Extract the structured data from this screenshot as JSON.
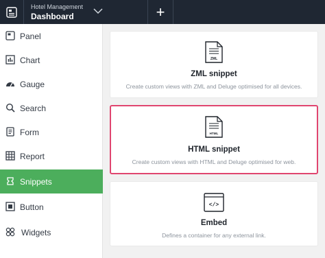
{
  "header": {
    "app_name": "Hotel Management",
    "page_title": "Dashboard",
    "add_label": "+"
  },
  "sidebar": {
    "items": [
      {
        "label": "Panel",
        "icon": "panel-icon"
      },
      {
        "label": "Chart",
        "icon": "chart-icon"
      },
      {
        "label": "Gauge",
        "icon": "gauge-icon"
      },
      {
        "label": "Search",
        "icon": "search-icon"
      },
      {
        "label": "Form",
        "icon": "form-icon"
      },
      {
        "label": "Report",
        "icon": "report-icon"
      },
      {
        "label": "Snippets",
        "icon": "snippets-icon",
        "active": true
      },
      {
        "label": "Button",
        "icon": "button-icon"
      },
      {
        "label": "Widgets",
        "icon": "widgets-icon"
      }
    ]
  },
  "cards": [
    {
      "icon_text": "ZML",
      "title": "ZML snippet",
      "description": "Create custom views with ZML and Deluge optimised for all devices."
    },
    {
      "icon_text": "HTML",
      "title": "HTML snippet",
      "description": "Create custom views with HTML and Deluge optimised for web.",
      "selected": true
    },
    {
      "icon_text": "</>",
      "title": "Embed",
      "description": "Defines a container for any external link."
    }
  ],
  "colors": {
    "topbar": "#1f2733",
    "active": "#4cae5c",
    "selected_border": "#e0456f"
  }
}
